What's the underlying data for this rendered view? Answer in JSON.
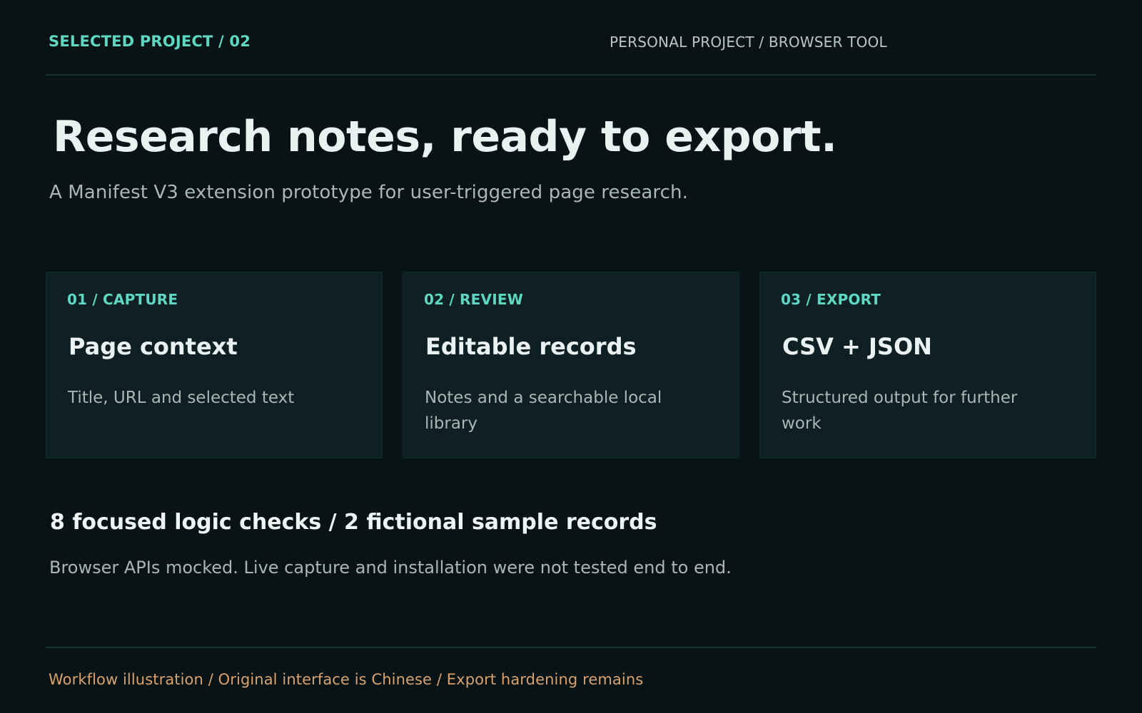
{
  "header": {
    "eyebrow": "SELECTED PROJECT / 02",
    "meta": "PERSONAL PROJECT / BROWSER TOOL"
  },
  "hero": {
    "title": "Research notes, ready to export.",
    "subtitle": "A Manifest V3 extension prototype for user-triggered page research."
  },
  "cards": [
    {
      "kicker": "01 / CAPTURE",
      "title": "Page context",
      "copy": "Title, URL and selected text"
    },
    {
      "kicker": "02 / REVIEW",
      "title": "Editable records",
      "copy": "Notes and a searchable local library"
    },
    {
      "kicker": "03 / EXPORT",
      "title": "CSV + JSON",
      "copy": "Structured output for further work"
    }
  ],
  "stats": {
    "title": "8 focused logic checks / 2 fictional sample records",
    "note": "Browser APIs mocked. Live capture and installation were not tested end to end."
  },
  "footer": {
    "note": "Workflow illustration / Original interface is Chinese / Export hardening remains"
  },
  "colors": {
    "background": "#081315",
    "card_background": "#0F2024",
    "accent_teal": "#5ED8C3",
    "accent_orange": "#D9A26E",
    "rule": "#183033"
  }
}
